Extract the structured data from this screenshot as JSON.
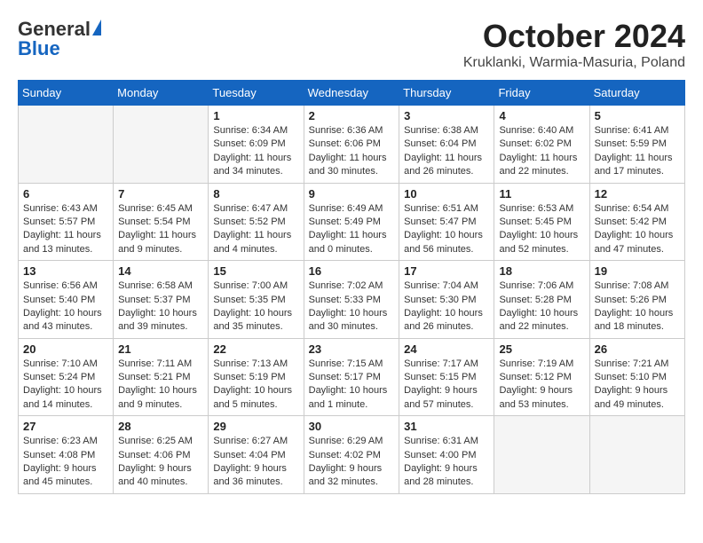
{
  "header": {
    "logo_general": "General",
    "logo_blue": "Blue",
    "month_title": "October 2024",
    "location": "Kruklanki, Warmia-Masuria, Poland"
  },
  "weekdays": [
    "Sunday",
    "Monday",
    "Tuesday",
    "Wednesday",
    "Thursday",
    "Friday",
    "Saturday"
  ],
  "weeks": [
    [
      {
        "day": "",
        "empty": true
      },
      {
        "day": "",
        "empty": true
      },
      {
        "day": "1",
        "sunrise": "Sunrise: 6:34 AM",
        "sunset": "Sunset: 6:09 PM",
        "daylight": "Daylight: 11 hours and 34 minutes."
      },
      {
        "day": "2",
        "sunrise": "Sunrise: 6:36 AM",
        "sunset": "Sunset: 6:06 PM",
        "daylight": "Daylight: 11 hours and 30 minutes."
      },
      {
        "day": "3",
        "sunrise": "Sunrise: 6:38 AM",
        "sunset": "Sunset: 6:04 PM",
        "daylight": "Daylight: 11 hours and 26 minutes."
      },
      {
        "day": "4",
        "sunrise": "Sunrise: 6:40 AM",
        "sunset": "Sunset: 6:02 PM",
        "daylight": "Daylight: 11 hours and 22 minutes."
      },
      {
        "day": "5",
        "sunrise": "Sunrise: 6:41 AM",
        "sunset": "Sunset: 5:59 PM",
        "daylight": "Daylight: 11 hours and 17 minutes."
      }
    ],
    [
      {
        "day": "6",
        "sunrise": "Sunrise: 6:43 AM",
        "sunset": "Sunset: 5:57 PM",
        "daylight": "Daylight: 11 hours and 13 minutes."
      },
      {
        "day": "7",
        "sunrise": "Sunrise: 6:45 AM",
        "sunset": "Sunset: 5:54 PM",
        "daylight": "Daylight: 11 hours and 9 minutes."
      },
      {
        "day": "8",
        "sunrise": "Sunrise: 6:47 AM",
        "sunset": "Sunset: 5:52 PM",
        "daylight": "Daylight: 11 hours and 4 minutes."
      },
      {
        "day": "9",
        "sunrise": "Sunrise: 6:49 AM",
        "sunset": "Sunset: 5:49 PM",
        "daylight": "Daylight: 11 hours and 0 minutes."
      },
      {
        "day": "10",
        "sunrise": "Sunrise: 6:51 AM",
        "sunset": "Sunset: 5:47 PM",
        "daylight": "Daylight: 10 hours and 56 minutes."
      },
      {
        "day": "11",
        "sunrise": "Sunrise: 6:53 AM",
        "sunset": "Sunset: 5:45 PM",
        "daylight": "Daylight: 10 hours and 52 minutes."
      },
      {
        "day": "12",
        "sunrise": "Sunrise: 6:54 AM",
        "sunset": "Sunset: 5:42 PM",
        "daylight": "Daylight: 10 hours and 47 minutes."
      }
    ],
    [
      {
        "day": "13",
        "sunrise": "Sunrise: 6:56 AM",
        "sunset": "Sunset: 5:40 PM",
        "daylight": "Daylight: 10 hours and 43 minutes."
      },
      {
        "day": "14",
        "sunrise": "Sunrise: 6:58 AM",
        "sunset": "Sunset: 5:37 PM",
        "daylight": "Daylight: 10 hours and 39 minutes."
      },
      {
        "day": "15",
        "sunrise": "Sunrise: 7:00 AM",
        "sunset": "Sunset: 5:35 PM",
        "daylight": "Daylight: 10 hours and 35 minutes."
      },
      {
        "day": "16",
        "sunrise": "Sunrise: 7:02 AM",
        "sunset": "Sunset: 5:33 PM",
        "daylight": "Daylight: 10 hours and 30 minutes."
      },
      {
        "day": "17",
        "sunrise": "Sunrise: 7:04 AM",
        "sunset": "Sunset: 5:30 PM",
        "daylight": "Daylight: 10 hours and 26 minutes."
      },
      {
        "day": "18",
        "sunrise": "Sunrise: 7:06 AM",
        "sunset": "Sunset: 5:28 PM",
        "daylight": "Daylight: 10 hours and 22 minutes."
      },
      {
        "day": "19",
        "sunrise": "Sunrise: 7:08 AM",
        "sunset": "Sunset: 5:26 PM",
        "daylight": "Daylight: 10 hours and 18 minutes."
      }
    ],
    [
      {
        "day": "20",
        "sunrise": "Sunrise: 7:10 AM",
        "sunset": "Sunset: 5:24 PM",
        "daylight": "Daylight: 10 hours and 14 minutes."
      },
      {
        "day": "21",
        "sunrise": "Sunrise: 7:11 AM",
        "sunset": "Sunset: 5:21 PM",
        "daylight": "Daylight: 10 hours and 9 minutes."
      },
      {
        "day": "22",
        "sunrise": "Sunrise: 7:13 AM",
        "sunset": "Sunset: 5:19 PM",
        "daylight": "Daylight: 10 hours and 5 minutes."
      },
      {
        "day": "23",
        "sunrise": "Sunrise: 7:15 AM",
        "sunset": "Sunset: 5:17 PM",
        "daylight": "Daylight: 10 hours and 1 minute."
      },
      {
        "day": "24",
        "sunrise": "Sunrise: 7:17 AM",
        "sunset": "Sunset: 5:15 PM",
        "daylight": "Daylight: 9 hours and 57 minutes."
      },
      {
        "day": "25",
        "sunrise": "Sunrise: 7:19 AM",
        "sunset": "Sunset: 5:12 PM",
        "daylight": "Daylight: 9 hours and 53 minutes."
      },
      {
        "day": "26",
        "sunrise": "Sunrise: 7:21 AM",
        "sunset": "Sunset: 5:10 PM",
        "daylight": "Daylight: 9 hours and 49 minutes."
      }
    ],
    [
      {
        "day": "27",
        "sunrise": "Sunrise: 6:23 AM",
        "sunset": "Sunset: 4:08 PM",
        "daylight": "Daylight: 9 hours and 45 minutes."
      },
      {
        "day": "28",
        "sunrise": "Sunrise: 6:25 AM",
        "sunset": "Sunset: 4:06 PM",
        "daylight": "Daylight: 9 hours and 40 minutes."
      },
      {
        "day": "29",
        "sunrise": "Sunrise: 6:27 AM",
        "sunset": "Sunset: 4:04 PM",
        "daylight": "Daylight: 9 hours and 36 minutes."
      },
      {
        "day": "30",
        "sunrise": "Sunrise: 6:29 AM",
        "sunset": "Sunset: 4:02 PM",
        "daylight": "Daylight: 9 hours and 32 minutes."
      },
      {
        "day": "31",
        "sunrise": "Sunrise: 6:31 AM",
        "sunset": "Sunset: 4:00 PM",
        "daylight": "Daylight: 9 hours and 28 minutes."
      },
      {
        "day": "",
        "empty": true
      },
      {
        "day": "",
        "empty": true
      }
    ]
  ]
}
